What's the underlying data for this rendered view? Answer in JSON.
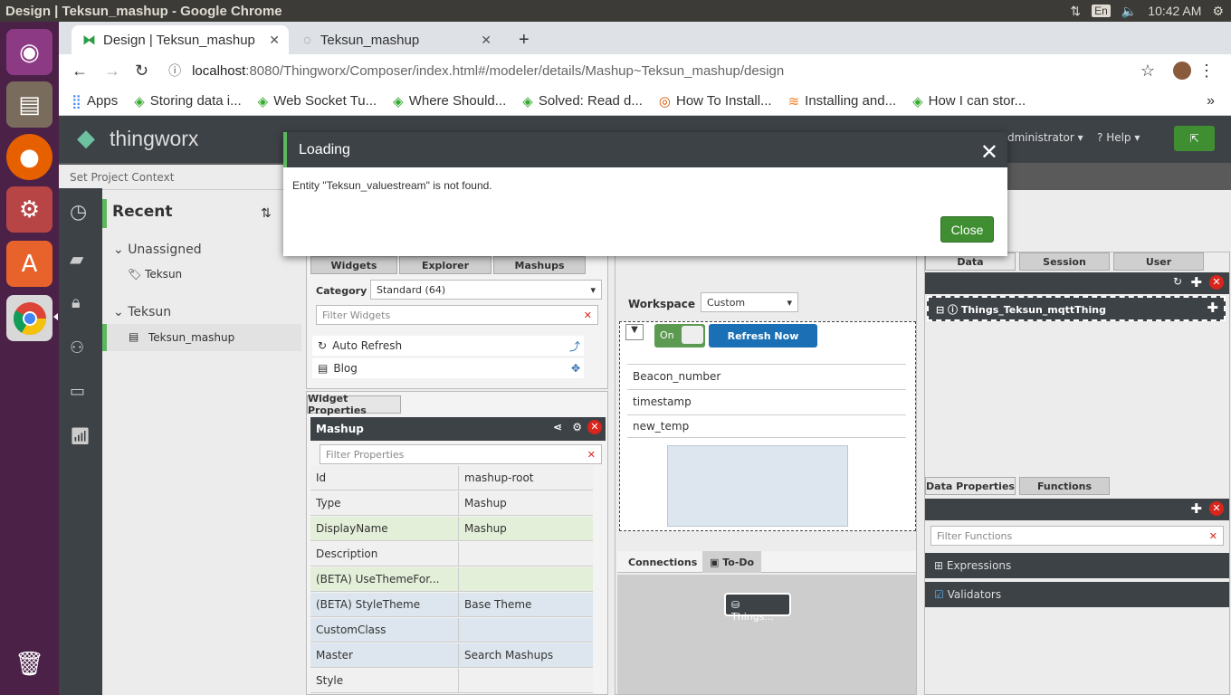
{
  "window": {
    "title": "Design | Teksun_mashup - Google Chrome"
  },
  "system": {
    "lang": "En",
    "time": "10:42 AM"
  },
  "launcher": {
    "apps": [
      "ubuntu-icon",
      "files-icon",
      "firefox-icon",
      "settings-icon",
      "software-icon",
      "chrome-icon"
    ]
  },
  "tabs": [
    {
      "label": "Design | Teksun_mashup"
    },
    {
      "label": "Teksun_mashup"
    }
  ],
  "address": {
    "host": "localhost",
    "path": ":8080/Thingworx/Composer/index.html#/modeler/details/Mashup~Teksun_mashup/design"
  },
  "bookmarks": [
    {
      "label": "Apps"
    },
    {
      "label": "Storing data i..."
    },
    {
      "label": "Web Socket Tu..."
    },
    {
      "label": "Where Should..."
    },
    {
      "label": "Solved: Read d..."
    },
    {
      "label": "How To Install..."
    },
    {
      "label": "Installing and..."
    },
    {
      "label": "How I can stor..."
    }
  ],
  "header": {
    "brand": "thingworx",
    "user": "Administrator",
    "help": "Help"
  },
  "project": {
    "context": "Set Project Context"
  },
  "recent": {
    "title": "Recent",
    "groups": [
      {
        "label": "Unassigned",
        "items": [
          "Teksun"
        ]
      },
      {
        "label": "Teksun",
        "items": [
          "Teksun_mashup"
        ]
      }
    ]
  },
  "widgets": {
    "tabs": [
      "Widgets",
      "Explorer",
      "Mashups"
    ],
    "category_label": "Category",
    "category_value": "Standard (64)",
    "filter_placeholder": "Filter Widgets",
    "items": [
      "Auto Refresh",
      "Blog"
    ]
  },
  "props": {
    "tab": "Widget Properties",
    "title": "Mashup",
    "filter_placeholder": "Filter Properties",
    "rows": [
      {
        "name": "Id",
        "value": "mashup-root"
      },
      {
        "name": "Type",
        "value": "Mashup"
      },
      {
        "name": "DisplayName",
        "value": "Mashup"
      },
      {
        "name": "Description",
        "value": ""
      },
      {
        "name": "(BETA) UseThemeFor...",
        "value": ""
      },
      {
        "name": "(BETA) StyleTheme",
        "value": "Base Theme"
      },
      {
        "name": "CustomClass",
        "value": ""
      },
      {
        "name": "Master",
        "value": "Search Mashups"
      },
      {
        "name": "Style",
        "value": ""
      }
    ]
  },
  "canvas": {
    "workspace_label": "Workspace",
    "workspace_value": "Custom",
    "toggle": "On",
    "refresh": "Refresh Now",
    "list": [
      "Beacon_number",
      "timestamp",
      "new_temp"
    ],
    "bottom_tabs": [
      "Connections",
      "To-Do"
    ],
    "node": "Things..."
  },
  "data_panel": {
    "tabs": [
      "Data",
      "Session",
      "User"
    ],
    "thing": "Things_Teksun_mqttThing",
    "sub_tabs": [
      "Data Properties",
      "Functions"
    ],
    "filter_placeholder": "Filter Functions",
    "sections": [
      "Expressions",
      "Validators"
    ]
  },
  "dialog": {
    "title": "Loading",
    "message": "Entity \"Teksun_valuestream\" is not found.",
    "close_label": "Close"
  }
}
